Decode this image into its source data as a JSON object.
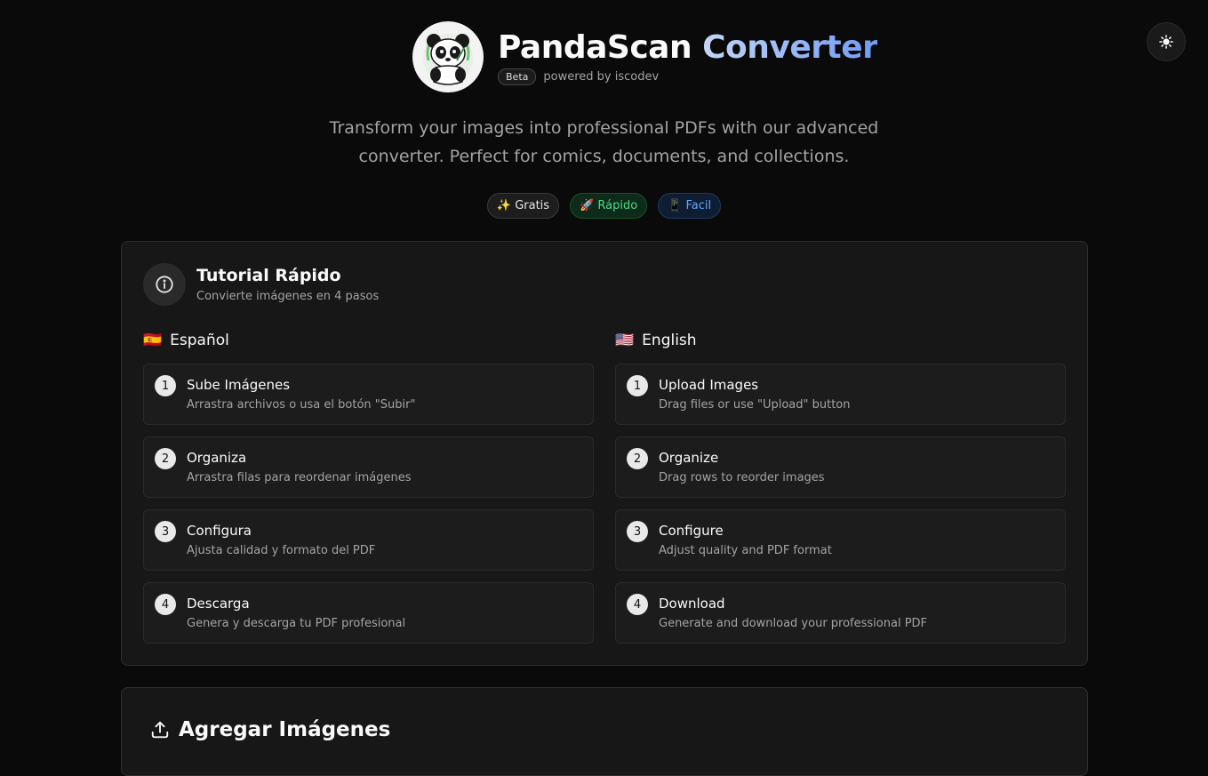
{
  "theme_toggle": {
    "icon": "sun-icon"
  },
  "header": {
    "title_main": "PandaScan",
    "title_accent": "Converter",
    "badge": "Beta",
    "powered_by": "powered by iscodev",
    "logo_icon": "panda-logo"
  },
  "tagline": {
    "line1": "Transform your images into professional PDFs with our advanced",
    "line2": "converter. Perfect for comics, documents, and collections."
  },
  "pills": [
    {
      "label": "✨ Gratis"
    },
    {
      "label": "🚀 Rápido"
    },
    {
      "label": "📱 Facil"
    }
  ],
  "tutorial": {
    "title": "Tutorial Rápido",
    "subtitle": "Convierte imágenes en 4 pasos",
    "icon": "info-icon",
    "spanish": {
      "flag": "🇪🇸",
      "heading": "Español",
      "steps": [
        {
          "num": "1",
          "title": "Sube Imágenes",
          "desc": "Arrastra archivos o usa el botón \"Subir\""
        },
        {
          "num": "2",
          "title": "Organiza",
          "desc": "Arrastra filas para reordenar imágenes"
        },
        {
          "num": "3",
          "title": "Configura",
          "desc": "Ajusta calidad y formato del PDF"
        },
        {
          "num": "4",
          "title": "Descarga",
          "desc": "Genera y descarga tu PDF profesional"
        }
      ]
    },
    "english": {
      "flag": "🇺🇸",
      "heading": "English",
      "steps": [
        {
          "num": "1",
          "title": "Upload Images",
          "desc": "Drag files or use \"Upload\" button"
        },
        {
          "num": "2",
          "title": "Organize",
          "desc": "Drag rows to reorder images"
        },
        {
          "num": "3",
          "title": "Configure",
          "desc": "Adjust quality and PDF format"
        },
        {
          "num": "4",
          "title": "Download",
          "desc": "Generate and download your professional PDF"
        }
      ]
    }
  },
  "add_images": {
    "title": "Agregar Imágenes",
    "icon": "upload-icon"
  }
}
